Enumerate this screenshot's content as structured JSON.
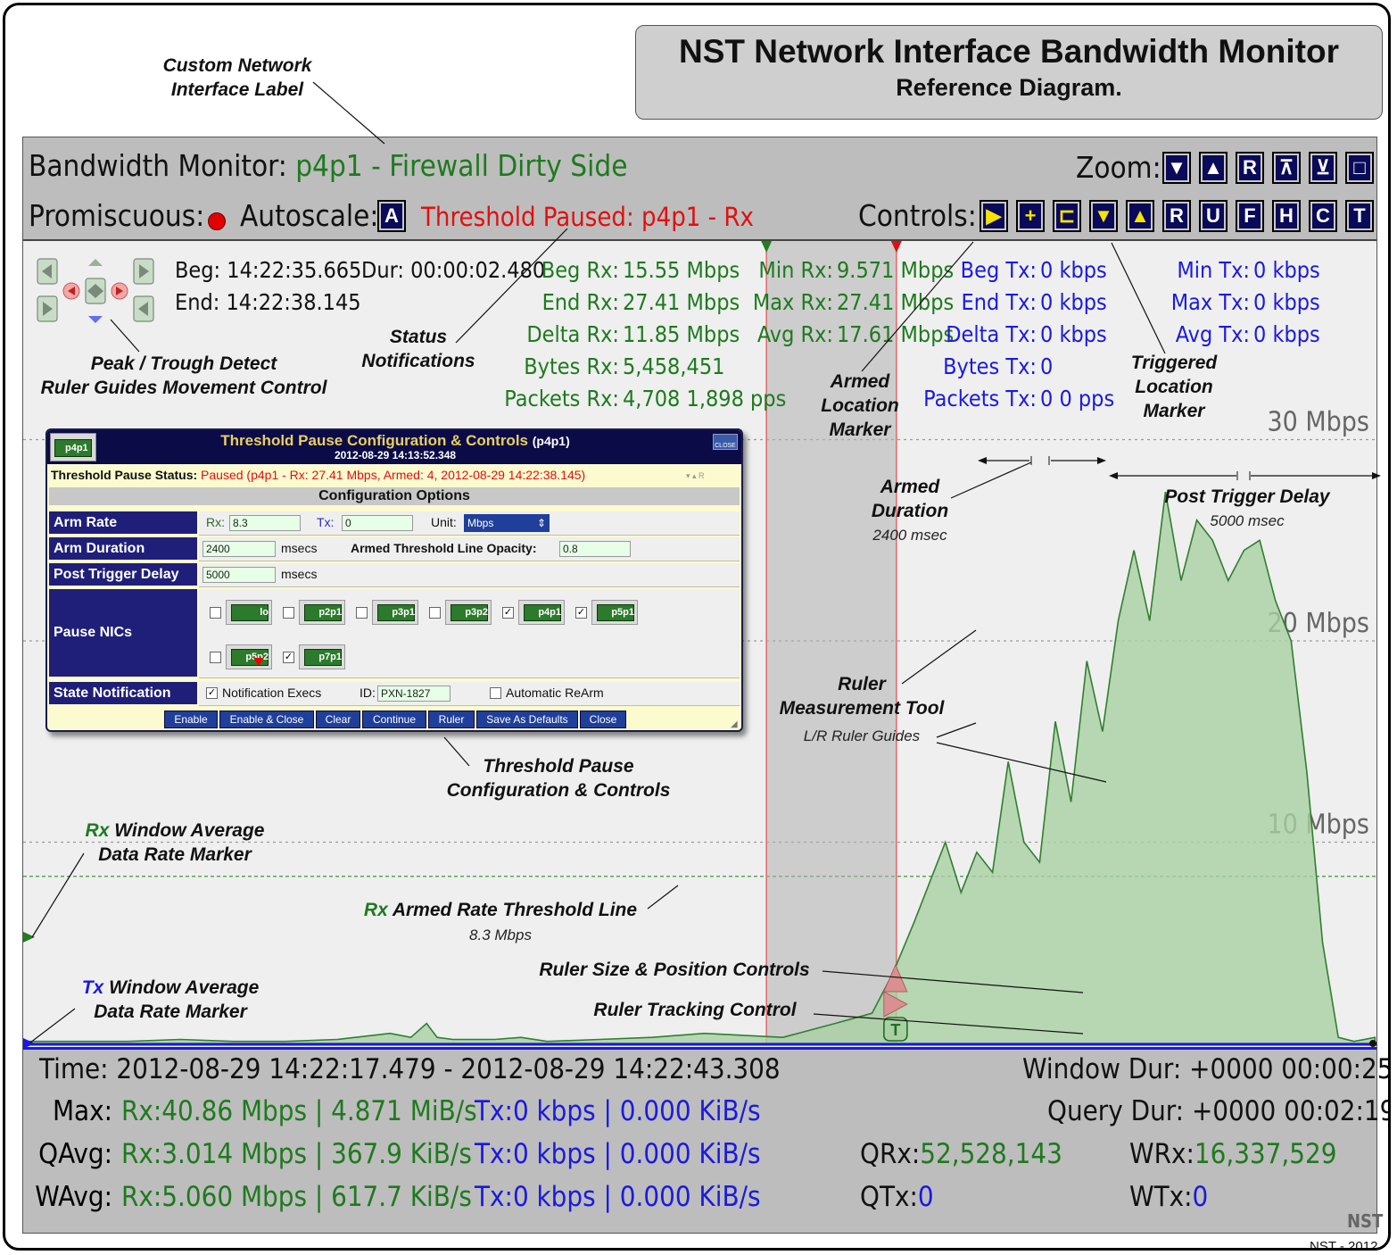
{
  "title": {
    "main": "NST Network Interface Bandwidth Monitor",
    "sub": "Reference Diagram."
  },
  "header": {
    "monitor_label": "Bandwidth Monitor:",
    "interface_name": "p4p1 - Firewall Dirty Side",
    "promiscuous_label": "Promiscuous:",
    "autoscale_label": "Autoscale:",
    "autoscale_button": "A",
    "threshold_status": "Threshold Paused: p4p1 - Rx",
    "zoom_label": "Zoom:",
    "zoom_buttons": [
      "▼",
      "▲",
      "R",
      "⊼",
      "⊻",
      "□"
    ],
    "controls_label": "Controls:",
    "control_buttons": [
      "▶",
      "+",
      "⊏",
      "▼",
      "▲",
      "R",
      "U",
      "F",
      "H",
      "C",
      "T"
    ]
  },
  "stats": {
    "beg_label": "Beg:",
    "beg_value": "14:22:35.665",
    "end_label": "End:",
    "end_value": "14:22:38.145",
    "dur_label": "Dur:",
    "dur_value": "00:00:02.480",
    "rx": [
      {
        "label": "Beg Rx:",
        "value": "15.55 Mbps"
      },
      {
        "label": "End Rx:",
        "value": "27.41 Mbps"
      },
      {
        "label": "Delta Rx:",
        "value": "11.85 Mbps"
      },
      {
        "label": "Bytes Rx:",
        "value": "5,458,451"
      },
      {
        "label": "Packets Rx:",
        "value": "4,708   1,898 pps"
      }
    ],
    "rx_mm": [
      {
        "label": "Min Rx:",
        "value": "9.571 Mbps"
      },
      {
        "label": "Max Rx:",
        "value": "27.41 Mbps"
      },
      {
        "label": "Avg Rx:",
        "value": "17.61 Mbps"
      }
    ],
    "tx": [
      {
        "label": "Beg Tx:",
        "value": "0 kbps"
      },
      {
        "label": "End Tx:",
        "value": "0 kbps"
      },
      {
        "label": "Delta Tx:",
        "value": "0 kbps"
      },
      {
        "label": "Bytes Tx:",
        "value": "0"
      },
      {
        "label": "Packets Tx:",
        "value": "0   0 pps"
      }
    ],
    "tx_mm": [
      {
        "label": "Min Tx:",
        "value": "0 kbps"
      },
      {
        "label": "Max Tx:",
        "value": "0 kbps"
      },
      {
        "label": "Avg Tx:",
        "value": "0 kbps"
      }
    ]
  },
  "annotations": {
    "custom_label": [
      "Custom Network",
      "Interface Label"
    ],
    "peak_trough": [
      "Peak / Trough Detect",
      "Ruler Guides Movement Control"
    ],
    "status_notif": [
      "Status",
      "Notifications"
    ],
    "armed_loc": [
      "Armed",
      "Location",
      "Marker"
    ],
    "triggered_loc": [
      "Triggered",
      "Location",
      "Marker"
    ],
    "armed_duration": [
      "Armed",
      "Duration"
    ],
    "armed_duration_value": "2400 msec",
    "post_trigger": "Post Trigger Delay",
    "post_trigger_value": "5000 msec",
    "ruler_tool": [
      "Ruler",
      "Measurement Tool"
    ],
    "lr_guides": "L/R Ruler Guides",
    "threshold_cfg": [
      "Threshold Pause",
      "Configuration & Controls"
    ],
    "rx_window_avg": [
      "Window Average",
      "Data Rate Marker"
    ],
    "rx_prefix": "Rx",
    "rx_armed_line": "Armed Rate Threshold Line",
    "rx_armed_value": "8.3 Mbps",
    "ruler_size_pos": "Ruler Size & Position Controls",
    "ruler_tracking": "Ruler Tracking Control",
    "tx_window_avg": [
      "Window Average",
      "Data Rate Marker"
    ],
    "tx_prefix": "Tx"
  },
  "chart_data": {
    "type": "area",
    "ylabel_ticks": [
      "10 Mbps",
      "20 Mbps",
      "30 Mbps"
    ],
    "yticks": [
      10,
      20,
      30
    ],
    "ylim": [
      0,
      40.86
    ],
    "xlim": [
      0,
      25.829
    ],
    "series": [
      {
        "name": "Rx",
        "x": [
          0.0,
          1.0,
          2.0,
          3.0,
          4.0,
          5.0,
          6.0,
          7.0,
          7.4,
          7.7,
          7.9,
          8.2,
          9.0,
          9.5,
          10.0,
          11.0,
          12.0,
          13.0,
          14.5,
          15.5,
          16.2,
          16.6,
          17.0,
          17.3,
          17.6,
          17.9,
          18.2,
          18.5,
          18.8,
          19.1,
          19.4,
          19.7,
          20.0,
          20.3,
          20.6,
          20.9,
          21.2,
          21.5,
          21.8,
          22.1,
          22.4,
          22.7,
          23.0,
          23.3,
          23.6,
          23.9,
          24.2,
          24.5,
          24.8,
          25.1,
          25.4,
          25.8
        ],
        "y": [
          0.1,
          0.1,
          0.1,
          0.2,
          0.1,
          0.1,
          0.2,
          0.5,
          0.3,
          1.0,
          0.3,
          0.2,
          0.2,
          0.3,
          0.1,
          0.2,
          0.3,
          0.5,
          0.3,
          1.0,
          1.5,
          3.5,
          6.0,
          8.0,
          10.0,
          7.5,
          9.5,
          8.5,
          14.0,
          10.0,
          9.0,
          16.0,
          12.0,
          19.0,
          15.5,
          21.0,
          24.5,
          21.0,
          27.4,
          23.0,
          26.0,
          25.0,
          23.0,
          24.5,
          25.0,
          22.0,
          20.0,
          13.5,
          5.0,
          0.3,
          0.1,
          0.3
        ]
      },
      {
        "name": "Tx",
        "x": [
          0,
          25.829
        ],
        "y": [
          0,
          0
        ]
      }
    ],
    "armed_threshold": 8.3,
    "ruler_begin": 14.186,
    "ruler_end": 16.666,
    "grid": true
  },
  "dialog": {
    "title": "Threshold Pause Configuration & Controls",
    "title_nic": "(p4p1)",
    "timestamp": "2012-08-29 14:13:52.348",
    "icon_label": "p4p1",
    "close_label": "CLOSE",
    "status_label": "Threshold Pause Status:",
    "status_value": "Paused (p4p1 - Rx: 27.41 Mbps, Armed: 4, 2012-08-29 14:22:38.145)",
    "section": "Configuration Options",
    "arm_rate_label": "Arm Rate",
    "rx_label": "Rx:",
    "rx_value": "8.3",
    "tx_label": "Tx:",
    "tx_value": "0",
    "unit_label": "Unit:",
    "unit_value": "Mbps",
    "arm_dur_label": "Arm Duration",
    "arm_dur_value": "2400",
    "msecs": "msecs",
    "opacity_label": "Armed Threshold Line Opacity:",
    "opacity_value": "0.8",
    "post_label": "Post Trigger Delay",
    "post_value": "5000",
    "pause_label": "Pause NICs",
    "nics": [
      {
        "name": "lo",
        "checked": false
      },
      {
        "name": "p2p1",
        "checked": false
      },
      {
        "name": "p3p1",
        "checked": false
      },
      {
        "name": "p3p2",
        "checked": false
      },
      {
        "name": "p4p1",
        "checked": true
      },
      {
        "name": "p5p1",
        "checked": true
      },
      {
        "name": "p5p2",
        "checked": false
      },
      {
        "name": "p7p1",
        "checked": true
      }
    ],
    "state_label": "State Notification",
    "notif_label": "Notification Execs",
    "id_label": "ID:",
    "id_value": "PXN-1827",
    "rearm_label": "Automatic ReArm",
    "buttons": [
      "Enable",
      "Enable & Close",
      "Clear",
      "Continue",
      "Ruler",
      "Save As Defaults",
      "Close"
    ]
  },
  "footer": {
    "time_label": "Time:",
    "time_value": "2012-08-29 14:22:17.479  -  2012-08-29 14:22:43.308",
    "window_dur_label": "Window Dur:",
    "window_dur_value": "+0000 00:00:25",
    "query_dur_label": "Query Dur:",
    "query_dur_value": "+0000 00:02:19",
    "max_label": "Max:",
    "qavg_label": "QAvg:",
    "wavg_label": "WAvg:",
    "rx_tag": "Rx:",
    "tx_tag": "Tx:",
    "max_rx": "40.86 Mbps | 4.871 MiB/s",
    "max_tx": "0 kbps | 0.000 KiB/s",
    "qavg_rx": "3.014 Mbps | 367.9 KiB/s",
    "qavg_tx": "0 kbps | 0.000 KiB/s",
    "wavg_rx": "5.060 Mbps | 617.7 KiB/s",
    "wavg_tx": "0 kbps | 0.000 KiB/s",
    "qrx_label": "QRx:",
    "qrx_value": "52,528,143",
    "qtx_label": "QTx:",
    "qtx_value": "0",
    "wrx_label": "WRx:",
    "wrx_value": "16,337,529",
    "wtx_label": "WTx:",
    "wtx_value": "0",
    "nst_logo": "NST"
  },
  "copyright": "NST - 2012",
  "colors": {
    "rx": "#1e7a1e",
    "tx": "#1a1ae0",
    "alert": "#e01010",
    "area_fill": "#a9cfa3",
    "ruler": "#e07070"
  }
}
